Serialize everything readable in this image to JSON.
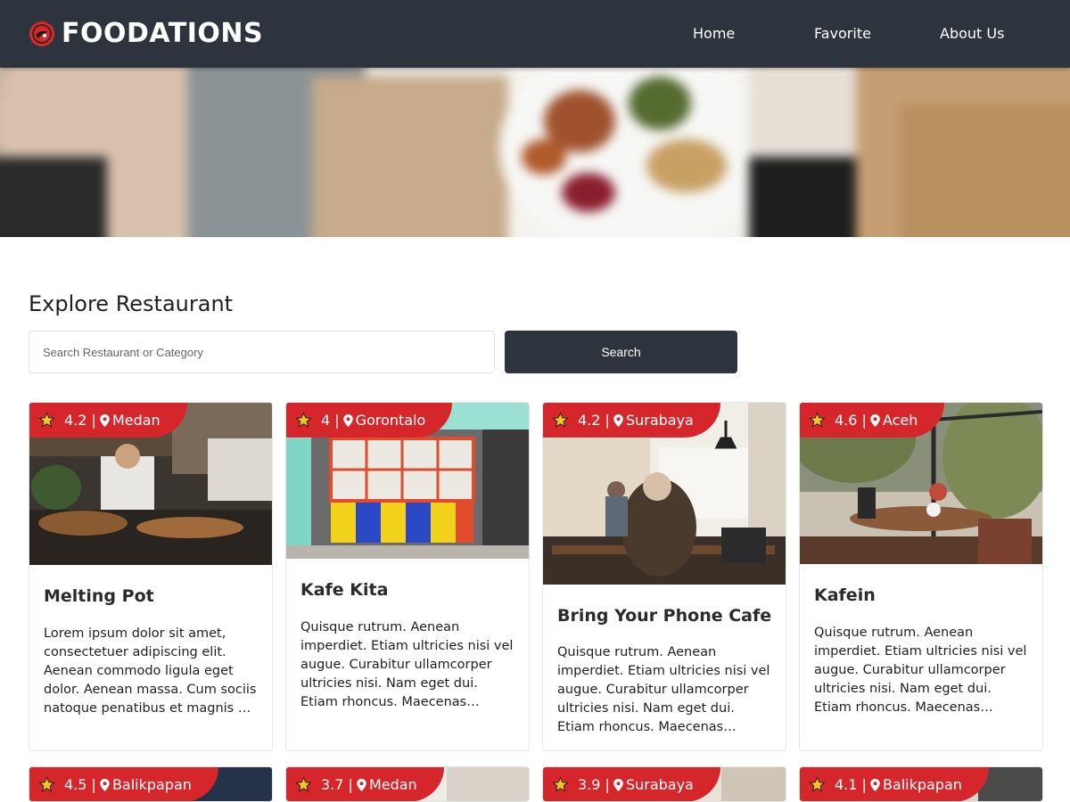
{
  "brand": {
    "name": "FOODATIONS",
    "logo_icon": "tomato-icon"
  },
  "nav": {
    "items": [
      "Home",
      "Favorite",
      "About Us"
    ]
  },
  "explore": {
    "title": "Explore Restaurant",
    "search_placeholder": "Search Restaurant or Category",
    "search_value": "",
    "search_button": "Search"
  },
  "colors": {
    "nav_bg": "#2e343d",
    "accent": "#d5262b",
    "star": "#f5c518"
  },
  "restaurants": [
    {
      "rating": "4.2",
      "city": "Medan",
      "name": "Melting Pot",
      "description": "Lorem ipsum dolor sit amet, consectetuer adipiscing elit. Aenean commodo ligula eget dolor. Aenean massa. Cum sociis natoque penatibus et magnis dis parturient montes"
    },
    {
      "rating": "4",
      "city": "Gorontalo",
      "name": "Kafe Kita",
      "description": "Quisque rutrum. Aenean imperdiet. Etiam ultricies nisi vel augue. Curabitur ullamcorper ultricies nisi. Nam eget dui. Etiam rhoncus. Maecenas tempus, tellus eget condimentum"
    },
    {
      "rating": "4.2",
      "city": "Surabaya",
      "name": "Bring Your Phone Cafe",
      "description": "Quisque rutrum. Aenean imperdiet. Etiam ultricies nisi vel augue. Curabitur ullamcorper ultricies nisi. Nam eget dui. Etiam rhoncus. Maecenas tempus, tellus eget condimentum"
    },
    {
      "rating": "4.6",
      "city": "Aceh",
      "name": "Kafein",
      "description": "Quisque rutrum. Aenean imperdiet. Etiam ultricies nisi vel augue. Curabitur ullamcorper ultricies nisi. Nam eget dui. Etiam rhoncus. Maecenas tempus, tellus eget condimentum"
    },
    {
      "rating": "4.5",
      "city": "Balikpapan",
      "name": "",
      "description": ""
    },
    {
      "rating": "3.7",
      "city": "Medan",
      "name": "",
      "description": ""
    },
    {
      "rating": "3.9",
      "city": "Surabaya",
      "name": "",
      "description": ""
    },
    {
      "rating": "4.1",
      "city": "Balikpapan",
      "name": "",
      "description": ""
    }
  ]
}
